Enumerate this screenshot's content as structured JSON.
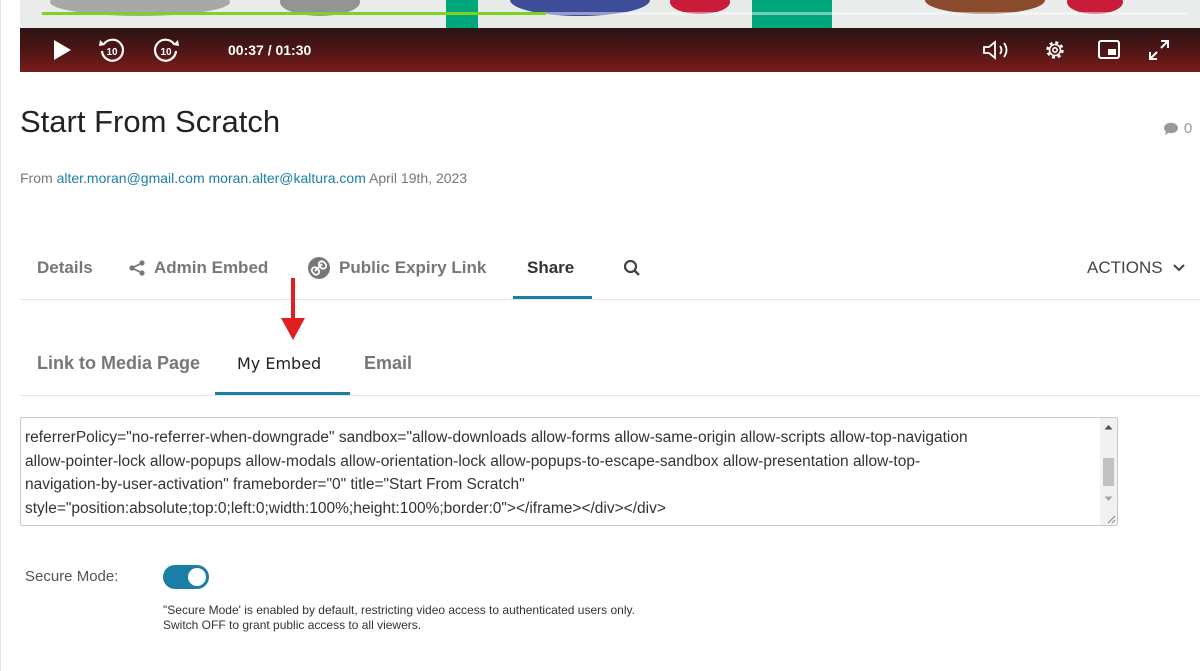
{
  "player": {
    "time": "00:37 / 01:30",
    "progress_fraction": 0.44,
    "colors": {
      "progress": "#7ed321",
      "bar": "#7a1b1b"
    },
    "icons": [
      "play-icon",
      "rewind-10-icon",
      "forward-10-icon",
      "volume-icon",
      "settings-gear-icon",
      "picture-in-picture-icon",
      "fullscreen-icon"
    ],
    "rewind_label": "10",
    "forward_label": "10"
  },
  "title": "Start From Scratch",
  "comment_count": "0",
  "byline": {
    "prefix": "From",
    "author1": "alter.moran@gmail.com",
    "author2": "moran.alter@kaltura.com",
    "date": "April 19th, 2023"
  },
  "main_tabs": {
    "details": "Details",
    "admin_embed": "Admin Embed",
    "public_expiry": "Public Expiry Link",
    "share": "Share",
    "active": "Share",
    "actions": "ACTIONS"
  },
  "sub_tabs": {
    "link": "Link to Media Page",
    "my_embed": "My Embed",
    "email": "Email",
    "active": "My Embed"
  },
  "embed_code": {
    "lines": [
      "referrerPolicy=\"no-referrer-when-downgrade\" sandbox=\"allow-downloads allow-forms allow-same-origin allow-scripts allow-top-navigation",
      "allow-pointer-lock allow-popups allow-modals allow-orientation-lock allow-popups-to-escape-sandbox allow-presentation allow-top-",
      "navigation-by-user-activation\" frameborder=\"0\" title=\"Start From Scratch\"",
      "style=\"position:absolute;top:0;left:0;width:100%;height:100%;border:0\"></iframe></div></div>"
    ]
  },
  "secure_mode": {
    "label": "Secure Mode:",
    "enabled": true,
    "note_line1": "\"Secure Mode' is enabled by default, restricting video access to authenticated users only.",
    "note_line2": "Switch OFF to grant public access to all viewers."
  },
  "colors": {
    "accent": "#1a7fa6",
    "annotation_arrow": "#e02020"
  }
}
